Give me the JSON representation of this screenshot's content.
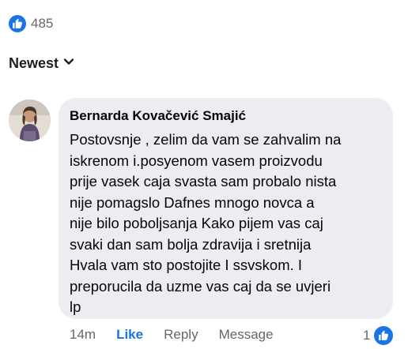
{
  "reactions": {
    "icon": "like-icon",
    "count": "485",
    "accent": "#1b74e4"
  },
  "sort": {
    "label": "Newest",
    "icon": "chevron-down-icon"
  },
  "comment": {
    "author": "Bernarda Kovačević Smajić",
    "lines": [
      "Postovsnje , zelim da vam se zahvalim na",
      "iskrenom i.posyenom vasem proizvodu",
      "prije vasek caja svasta sam probalo nista",
      "nije  pomagslo Dafnes mnogo novca a",
      "nije bilo poboljsanja Kako pijem vas caj",
      "svaki dan sam bolja zdravija i sretnija",
      "Hvala vam sto postojite I ssvskom. I",
      "preporucila da uzme vas caj da se uvjeri",
      "lp"
    ],
    "bubble_color": "#ecedf1",
    "actions": {
      "timestamp": "14m",
      "like": "Like",
      "reply": "Reply",
      "message": "Message"
    },
    "reaction_count": "1",
    "reaction_icon": "like-icon"
  }
}
